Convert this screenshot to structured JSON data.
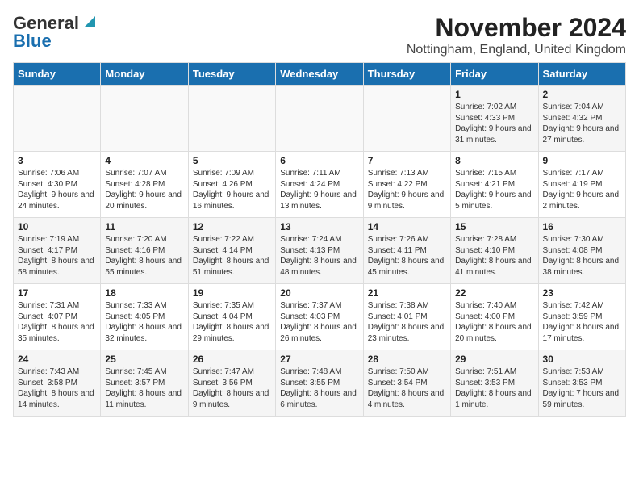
{
  "logo": {
    "line1": "General",
    "line2": "Blue"
  },
  "title": "November 2024",
  "subtitle": "Nottingham, England, United Kingdom",
  "days_of_week": [
    "Sunday",
    "Monday",
    "Tuesday",
    "Wednesday",
    "Thursday",
    "Friday",
    "Saturday"
  ],
  "weeks": [
    [
      {
        "day": "",
        "info": ""
      },
      {
        "day": "",
        "info": ""
      },
      {
        "day": "",
        "info": ""
      },
      {
        "day": "",
        "info": ""
      },
      {
        "day": "",
        "info": ""
      },
      {
        "day": "1",
        "info": "Sunrise: 7:02 AM\nSunset: 4:33 PM\nDaylight: 9 hours and 31 minutes."
      },
      {
        "day": "2",
        "info": "Sunrise: 7:04 AM\nSunset: 4:32 PM\nDaylight: 9 hours and 27 minutes."
      }
    ],
    [
      {
        "day": "3",
        "info": "Sunrise: 7:06 AM\nSunset: 4:30 PM\nDaylight: 9 hours and 24 minutes."
      },
      {
        "day": "4",
        "info": "Sunrise: 7:07 AM\nSunset: 4:28 PM\nDaylight: 9 hours and 20 minutes."
      },
      {
        "day": "5",
        "info": "Sunrise: 7:09 AM\nSunset: 4:26 PM\nDaylight: 9 hours and 16 minutes."
      },
      {
        "day": "6",
        "info": "Sunrise: 7:11 AM\nSunset: 4:24 PM\nDaylight: 9 hours and 13 minutes."
      },
      {
        "day": "7",
        "info": "Sunrise: 7:13 AM\nSunset: 4:22 PM\nDaylight: 9 hours and 9 minutes."
      },
      {
        "day": "8",
        "info": "Sunrise: 7:15 AM\nSunset: 4:21 PM\nDaylight: 9 hours and 5 minutes."
      },
      {
        "day": "9",
        "info": "Sunrise: 7:17 AM\nSunset: 4:19 PM\nDaylight: 9 hours and 2 minutes."
      }
    ],
    [
      {
        "day": "10",
        "info": "Sunrise: 7:19 AM\nSunset: 4:17 PM\nDaylight: 8 hours and 58 minutes."
      },
      {
        "day": "11",
        "info": "Sunrise: 7:20 AM\nSunset: 4:16 PM\nDaylight: 8 hours and 55 minutes."
      },
      {
        "day": "12",
        "info": "Sunrise: 7:22 AM\nSunset: 4:14 PM\nDaylight: 8 hours and 51 minutes."
      },
      {
        "day": "13",
        "info": "Sunrise: 7:24 AM\nSunset: 4:13 PM\nDaylight: 8 hours and 48 minutes."
      },
      {
        "day": "14",
        "info": "Sunrise: 7:26 AM\nSunset: 4:11 PM\nDaylight: 8 hours and 45 minutes."
      },
      {
        "day": "15",
        "info": "Sunrise: 7:28 AM\nSunset: 4:10 PM\nDaylight: 8 hours and 41 minutes."
      },
      {
        "day": "16",
        "info": "Sunrise: 7:30 AM\nSunset: 4:08 PM\nDaylight: 8 hours and 38 minutes."
      }
    ],
    [
      {
        "day": "17",
        "info": "Sunrise: 7:31 AM\nSunset: 4:07 PM\nDaylight: 8 hours and 35 minutes."
      },
      {
        "day": "18",
        "info": "Sunrise: 7:33 AM\nSunset: 4:05 PM\nDaylight: 8 hours and 32 minutes."
      },
      {
        "day": "19",
        "info": "Sunrise: 7:35 AM\nSunset: 4:04 PM\nDaylight: 8 hours and 29 minutes."
      },
      {
        "day": "20",
        "info": "Sunrise: 7:37 AM\nSunset: 4:03 PM\nDaylight: 8 hours and 26 minutes."
      },
      {
        "day": "21",
        "info": "Sunrise: 7:38 AM\nSunset: 4:01 PM\nDaylight: 8 hours and 23 minutes."
      },
      {
        "day": "22",
        "info": "Sunrise: 7:40 AM\nSunset: 4:00 PM\nDaylight: 8 hours and 20 minutes."
      },
      {
        "day": "23",
        "info": "Sunrise: 7:42 AM\nSunset: 3:59 PM\nDaylight: 8 hours and 17 minutes."
      }
    ],
    [
      {
        "day": "24",
        "info": "Sunrise: 7:43 AM\nSunset: 3:58 PM\nDaylight: 8 hours and 14 minutes."
      },
      {
        "day": "25",
        "info": "Sunrise: 7:45 AM\nSunset: 3:57 PM\nDaylight: 8 hours and 11 minutes."
      },
      {
        "day": "26",
        "info": "Sunrise: 7:47 AM\nSunset: 3:56 PM\nDaylight: 8 hours and 9 minutes."
      },
      {
        "day": "27",
        "info": "Sunrise: 7:48 AM\nSunset: 3:55 PM\nDaylight: 8 hours and 6 minutes."
      },
      {
        "day": "28",
        "info": "Sunrise: 7:50 AM\nSunset: 3:54 PM\nDaylight: 8 hours and 4 minutes."
      },
      {
        "day": "29",
        "info": "Sunrise: 7:51 AM\nSunset: 3:53 PM\nDaylight: 8 hours and 1 minute."
      },
      {
        "day": "30",
        "info": "Sunrise: 7:53 AM\nSunset: 3:53 PM\nDaylight: 7 hours and 59 minutes."
      }
    ]
  ]
}
